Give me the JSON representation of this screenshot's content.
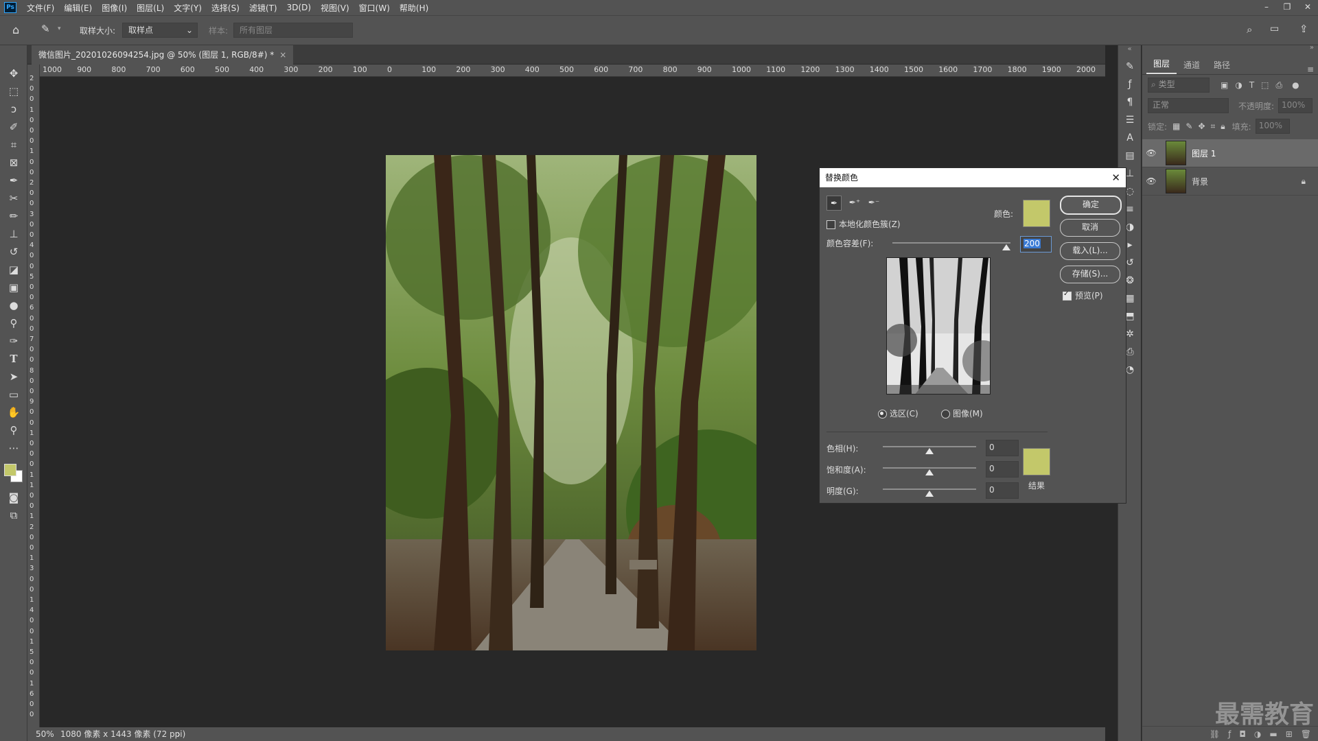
{
  "app_logo": "Ps",
  "menu": [
    "文件(F)",
    "编辑(E)",
    "图像(I)",
    "图层(L)",
    "文字(Y)",
    "选择(S)",
    "滤镜(T)",
    "3D(D)",
    "视图(V)",
    "窗口(W)",
    "帮助(H)"
  ],
  "window_controls": [
    "–",
    "❐",
    "✕"
  ],
  "options": {
    "sample_size_label": "取样大小:",
    "sample_size_value": "取样点",
    "sample_label": "样本:",
    "sample_value": "所有图层"
  },
  "document": {
    "tab_title": "微信图片_20201026094254.jpg @ 50% (图层 1, RGB/8#) *",
    "tab_close": "×"
  },
  "ruler_h": [
    "1000",
    "900",
    "800",
    "700",
    "600",
    "500",
    "400",
    "300",
    "200",
    "100",
    "0",
    "100",
    "200",
    "300",
    "400",
    "500",
    "600",
    "700",
    "800",
    "900",
    "1000",
    "1100",
    "1200",
    "1300",
    "1400",
    "1500",
    "1600",
    "1700",
    "1800",
    "1900",
    "2000"
  ],
  "ruler_v": [
    "2",
    "0",
    "0",
    "1",
    "0",
    "0",
    "0",
    "1",
    "0",
    "0",
    "2",
    "0",
    "0",
    "3",
    "0",
    "0",
    "4",
    "0",
    "0",
    "5",
    "0",
    "0",
    "6",
    "0",
    "0",
    "7",
    "0",
    "0",
    "8",
    "0",
    "0",
    "9",
    "0",
    "0",
    "1",
    "0",
    "0",
    "0",
    "1",
    "1",
    "0",
    "0",
    "1",
    "2",
    "0",
    "0",
    "1",
    "3",
    "0",
    "0",
    "1",
    "4",
    "0",
    "0",
    "1",
    "5",
    "0",
    "0",
    "1",
    "6",
    "0",
    "0"
  ],
  "status": {
    "zoom": "50%",
    "info": "1080 像素 x 1443 像素 (72 ppi)"
  },
  "panels": {
    "tabs": [
      "图层",
      "通道",
      "路径"
    ],
    "filter_placeholder": "类型",
    "blend_mode": "正常",
    "opacity_label": "不透明度:",
    "opacity_value": "100%",
    "lock_label": "锁定:",
    "fill_label": "填充:",
    "fill_value": "100%",
    "layers": [
      {
        "name": "图层 1",
        "selected": true
      },
      {
        "name": "背景",
        "locked": true
      }
    ]
  },
  "dialog": {
    "title": "替换颜色",
    "localized_label": "本地化颜色簇(Z)",
    "color_label": "颜色:",
    "tolerance_label": "颜色容差(F):",
    "tolerance_value": "200",
    "radio_selection": "选区(C)",
    "radio_image": "图像(M)",
    "ok": "确定",
    "cancel": "取消",
    "load": "载入(L)...",
    "save": "存储(S)...",
    "preview": "预览(P)",
    "hue_label": "色相(H):",
    "hue_value": "0",
    "sat_label": "饱和度(A):",
    "sat_value": "0",
    "light_label": "明度(G):",
    "light_value": "0",
    "result_label": "结果",
    "swatch_color": "#c3c86a"
  },
  "watermark": "最需教育"
}
